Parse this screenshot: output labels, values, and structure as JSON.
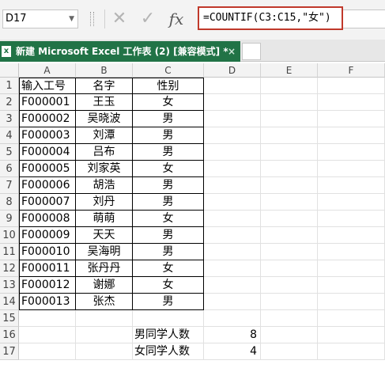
{
  "formula_bar": {
    "name_box": "D17",
    "cancel_glyph": "✕",
    "enter_glyph": "✓",
    "fx_glyph": "fx",
    "formula": "=COUNTIF(C3:C15,\"女\")"
  },
  "tab": {
    "title": "新建 Microsoft Excel 工作表 (2)  [兼容模式] *",
    "close_glyph": "×",
    "icon_letter": "x"
  },
  "columns": [
    "A",
    "B",
    "C",
    "D",
    "E",
    "F"
  ],
  "rows": [
    "1",
    "2",
    "3",
    "4",
    "5",
    "6",
    "7",
    "8",
    "9",
    "10",
    "11",
    "12",
    "13",
    "14",
    "15",
    "16",
    "17"
  ],
  "table": {
    "headers": [
      "输入工号",
      "名字",
      "性别"
    ],
    "records": [
      [
        "F000001",
        "王玉",
        "女"
      ],
      [
        "F000002",
        "吴晓波",
        "男"
      ],
      [
        "F000003",
        "刘潭",
        "男"
      ],
      [
        "F000004",
        "吕布",
        "男"
      ],
      [
        "F000005",
        "刘家英",
        "女"
      ],
      [
        "F000006",
        "胡浩",
        "男"
      ],
      [
        "F000007",
        "刘丹",
        "男"
      ],
      [
        "F000008",
        "萌萌",
        "女"
      ],
      [
        "F000009",
        "天天",
        "男"
      ],
      [
        "F000010",
        "吴海明",
        "男"
      ],
      [
        "F000011",
        "张丹丹",
        "女"
      ],
      [
        "F000012",
        "谢娜",
        "女"
      ],
      [
        "F000013",
        "张杰",
        "男"
      ]
    ]
  },
  "summary": [
    {
      "label": "男同学人数",
      "value": "8"
    },
    {
      "label": "女同学人数",
      "value": "4"
    }
  ],
  "colors": {
    "tab_active": "#217346",
    "formula_highlight": "#c0392b"
  }
}
